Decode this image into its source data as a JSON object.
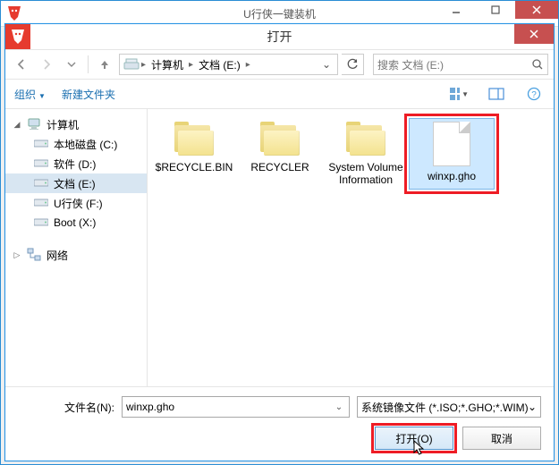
{
  "parent": {
    "title": "U行侠一键装机"
  },
  "dialog": {
    "title": "打开"
  },
  "breadcrumb": {
    "seg1": "计算机",
    "seg2": "文档 (E:)"
  },
  "search": {
    "placeholder": "搜索 文档 (E:)"
  },
  "toolbar": {
    "organize": "组织",
    "newfolder": "新建文件夹"
  },
  "sidebar": {
    "computer": "计算机",
    "drives": {
      "c": "本地磁盘 (C:)",
      "d": "软件 (D:)",
      "e": "文档 (E:)",
      "f": "U行侠 (F:)",
      "x": "Boot (X:)"
    },
    "network": "网络"
  },
  "files": {
    "f0": "$RECYCLE.BIN",
    "f1": "RECYCLER",
    "f2": "System Volume Information",
    "f3": "winxp.gho"
  },
  "bottom": {
    "filename_label": "文件名(N):",
    "filename_value": "winxp.gho",
    "filetype": "系统镜像文件 (*.ISO;*.GHO;*.WIM)",
    "open": "打开(O)",
    "cancel": "取消"
  }
}
